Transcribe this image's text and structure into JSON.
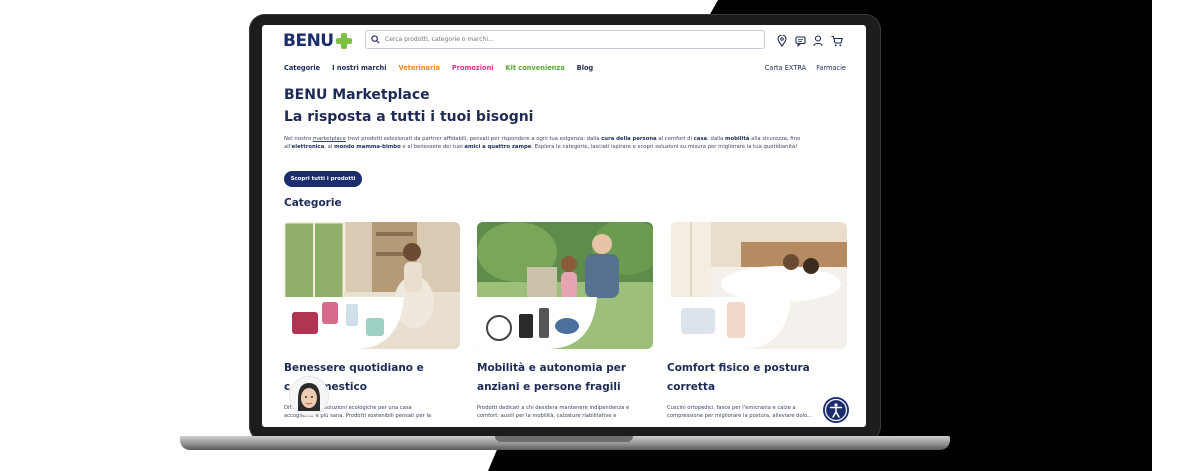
{
  "brand": {
    "name": "BENU",
    "accent": "#7cc242",
    "primary": "#1b2d6b"
  },
  "search": {
    "placeholder": "Cerca prodotti, categorie o marchi..."
  },
  "header_icons": [
    "location-pin-icon",
    "chat-icon",
    "user-icon",
    "cart-icon"
  ],
  "nav": {
    "items": [
      {
        "label": "Categorie",
        "color": "#1d2a55"
      },
      {
        "label": "I nostri marchi",
        "color": "#1d2a55"
      },
      {
        "label": "Veterinaria",
        "color": "#e8892b"
      },
      {
        "label": "Promozioni",
        "color": "#d63384"
      },
      {
        "label": "Kit convenienza",
        "color": "#5aa832"
      },
      {
        "label": "Blog",
        "color": "#1d2a55"
      }
    ],
    "right": [
      "Carta EXTRA",
      "Farmacie"
    ]
  },
  "hero": {
    "title": "BENU Marketplace",
    "subtitle": "La risposta a tutti i tuoi bisogni",
    "intro": {
      "p1": "Nel nostro ",
      "link": "marketplace",
      "p2": " trovi prodotti selezionati da partner affidabili, pensati per rispondere a ogni tua esigenza: dalla ",
      "b1": "cura della persona",
      "p3": " al comfort di ",
      "b2": "casa",
      "p4": ", dalla ",
      "b3": "mobilità",
      "p5": " alla sicurezza, fino all'",
      "b4": "elettronica",
      "p6": ", al ",
      "b5": "mondo mamma-bimbo",
      "p7": " e al benessere dei tuoi ",
      "b6": "amici a quattro zampe",
      "p8": ". Esplora le categorie, lasciati ispirare e scopri soluzioni su misura per migliorare la tua quotidianità!"
    },
    "cta": "Scopri tutti i prodotti"
  },
  "categories": {
    "title": "Categorie",
    "cards": [
      {
        "title_line1": "Benessere quotidiano e",
        "title_line2": "c... domestico",
        "desc_line1": "Dif... umatori e soluzioni ecologiche per una casa",
        "desc_line2": "accogliente e più sana. Prodotti sostenibili pensati per la"
      },
      {
        "title_line1": "Mobilità e autonomia per",
        "title_line2": "anziani e persone fragili",
        "desc_line1": "Prodotti dedicati a chi desidera mantenere indipendenza e",
        "desc_line2": "comfort: ausili per la mobilità, calzature riabilitative e"
      },
      {
        "title_line1": "Comfort fisico e postura",
        "title_line2": "corretta",
        "desc_line1": "Cuscini ortopedici, fasce per l'emicrania e calze a",
        "desc_line2": "compressione per migliorare la postura, alleviare dolo..."
      }
    ]
  }
}
